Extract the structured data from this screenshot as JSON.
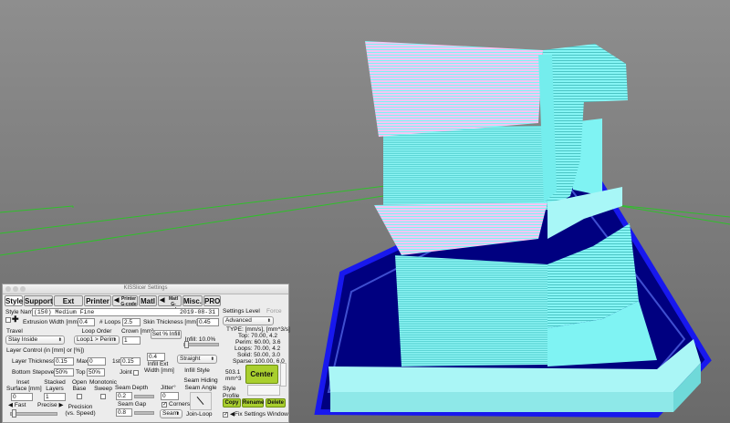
{
  "window_title": "KISSlicer Settings",
  "colors": {
    "grid": "#2fc02a",
    "bed": "#000080",
    "bed_border": "#1818ee",
    "bed_base": "#aaf6f6",
    "model_cyan": "#7ff3f3",
    "model_pink": "#f3c7f3",
    "center_button": "#a9cf2e"
  },
  "tabs": [
    "Style",
    "Support",
    "Ext Map",
    "Printer",
    "Printer G-code",
    "Matl",
    "Matl G-code",
    "Misc.",
    "PRO"
  ],
  "tab_icons": [
    "speaker-icon",
    "speaker-icon"
  ],
  "style_name": {
    "label": "Style Name",
    "value": "(150) Medium Fine",
    "date": "2019-08-31"
  },
  "extrusion_width": {
    "label": "Extrusion Width [mm]",
    "value": "0.4"
  },
  "loops": {
    "label": "# Loops",
    "value": "2.5"
  },
  "skin_thickness": {
    "label": "Skin Thickness [mm]",
    "value": "0.45"
  },
  "travel": {
    "label": "Travel",
    "value": "Stay Inside"
  },
  "loop_order": {
    "label": "Loop Order",
    "value": "Loop1 > Perim"
  },
  "crown": {
    "label": "Crown [mm]",
    "value": "1"
  },
  "set_infill": {
    "label": "Set % Infill"
  },
  "infill_pct": "Infill: 10.0%",
  "layer_control": "Layer Control (in [mm] or [%])",
  "layer_thickness": {
    "label": "Layer Thickness",
    "value": "0.15",
    "max_label": "Max",
    "max_value": "0",
    "first_label": "1st",
    "first_value": "0.15"
  },
  "bottom_stepover": {
    "label": "Bottom Stepover",
    "value": "50%",
    "top_label": "Top",
    "top_value": "50%"
  },
  "joint_label": "Joint",
  "infill_ext_width": {
    "value": "0.4",
    "label1": "Infill Ext",
    "label2": "Width [mm]"
  },
  "infill_style": {
    "label": "Infill Style",
    "value": "Straight"
  },
  "inset_surface": {
    "label1": "Inset",
    "label2": "Surface [mm]",
    "value": "0"
  },
  "stacked_layers": {
    "label1": "Stacked",
    "label2": "Layers",
    "value": "1"
  },
  "open_base": {
    "label1": "Open",
    "label2": "Base"
  },
  "monotonic_sweep": {
    "label1": "Monotonic",
    "label2": "Sweep"
  },
  "seam_depth": {
    "label": "Seam Depth",
    "value": "0.2"
  },
  "jitter": {
    "label": "Jitter°",
    "value": "0"
  },
  "seam_hiding": "Seam Hiding",
  "seam_angle": "Seam Angle",
  "seam_gap": {
    "label": "Seam Gap",
    "value": "0.8"
  },
  "corners": {
    "label": "Corners",
    "checked": "✓"
  },
  "seam_select": "Seam",
  "join_loop": "Join-Loop",
  "fast": "Fast",
  "precise": "Precise",
  "precision": {
    "label1": "Precision",
    "label2": "(vs. Speed)"
  },
  "settings_level": {
    "label": "Settings Level",
    "fa": "Force",
    "value": "Advanced"
  },
  "speed_header": "TYPE: [mm/s], [mm^3/s]",
  "speed_rows": [
    "Top:  70.00,  4.2",
    "Perim:  60.00,  3.6",
    "Loops:  70.00,  4.2",
    "Solid:  50.00,  3.0",
    "Sparse: 100.00,  6.0"
  ],
  "volume": {
    "value": "503.1",
    "unit": "mm^3"
  },
  "center_button": "Center",
  "style_profile": "Style Profile",
  "copy_button": "Copy",
  "rename_button": "Rename",
  "delete_button": "Delete",
  "fix_settings": {
    "label": "Fix Settings Window",
    "checked": "✓"
  }
}
